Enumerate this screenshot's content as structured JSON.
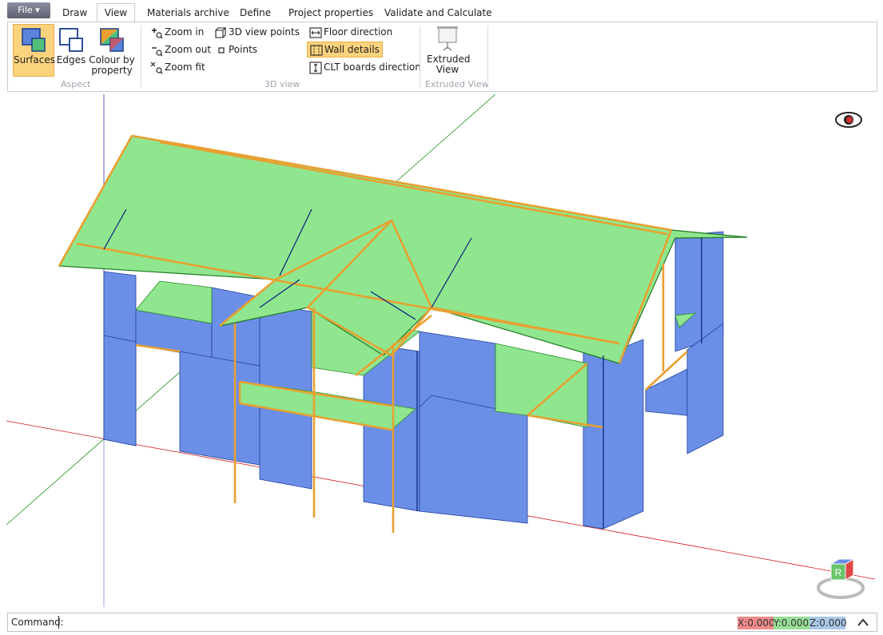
{
  "menu": {
    "file_label": "File ▾",
    "tabs": [
      "Draw",
      "View",
      "Materials archive",
      "Define",
      "Project properties",
      "Validate and Calculate"
    ],
    "active_tab": "View"
  },
  "ribbon": {
    "aspect": {
      "group_label": "Aspect",
      "surfaces": "Surfaces",
      "edges": "Edges",
      "colour_line1": "Colour by",
      "colour_line2": "property"
    },
    "view3d": {
      "group_label": "3D view",
      "zoom_in": "Zoom in",
      "zoom_out": "Zoom out",
      "zoom_fit": "Zoom fit",
      "view_points": "3D view points",
      "points": "Points",
      "floor_direction": "Floor direction",
      "wall_details": "Wall details",
      "clt_direction": "CLT boards direction"
    },
    "extruded": {
      "group_label": "Extruded View",
      "btn_line1": "Extruded",
      "btn_line2": "View"
    }
  },
  "viewcube": {
    "face_label": "R"
  },
  "command": {
    "label": "Command:",
    "x_label": "X:",
    "x_value": "0.000",
    "y_label": "Y:",
    "y_value": "0.000",
    "z_label": "Z:",
    "z_value": "0.000"
  },
  "colors": {
    "wall": "#6b8fe6",
    "roof": "#8fe68f",
    "edge": "#e8a030",
    "accent": "#fcd37d"
  }
}
